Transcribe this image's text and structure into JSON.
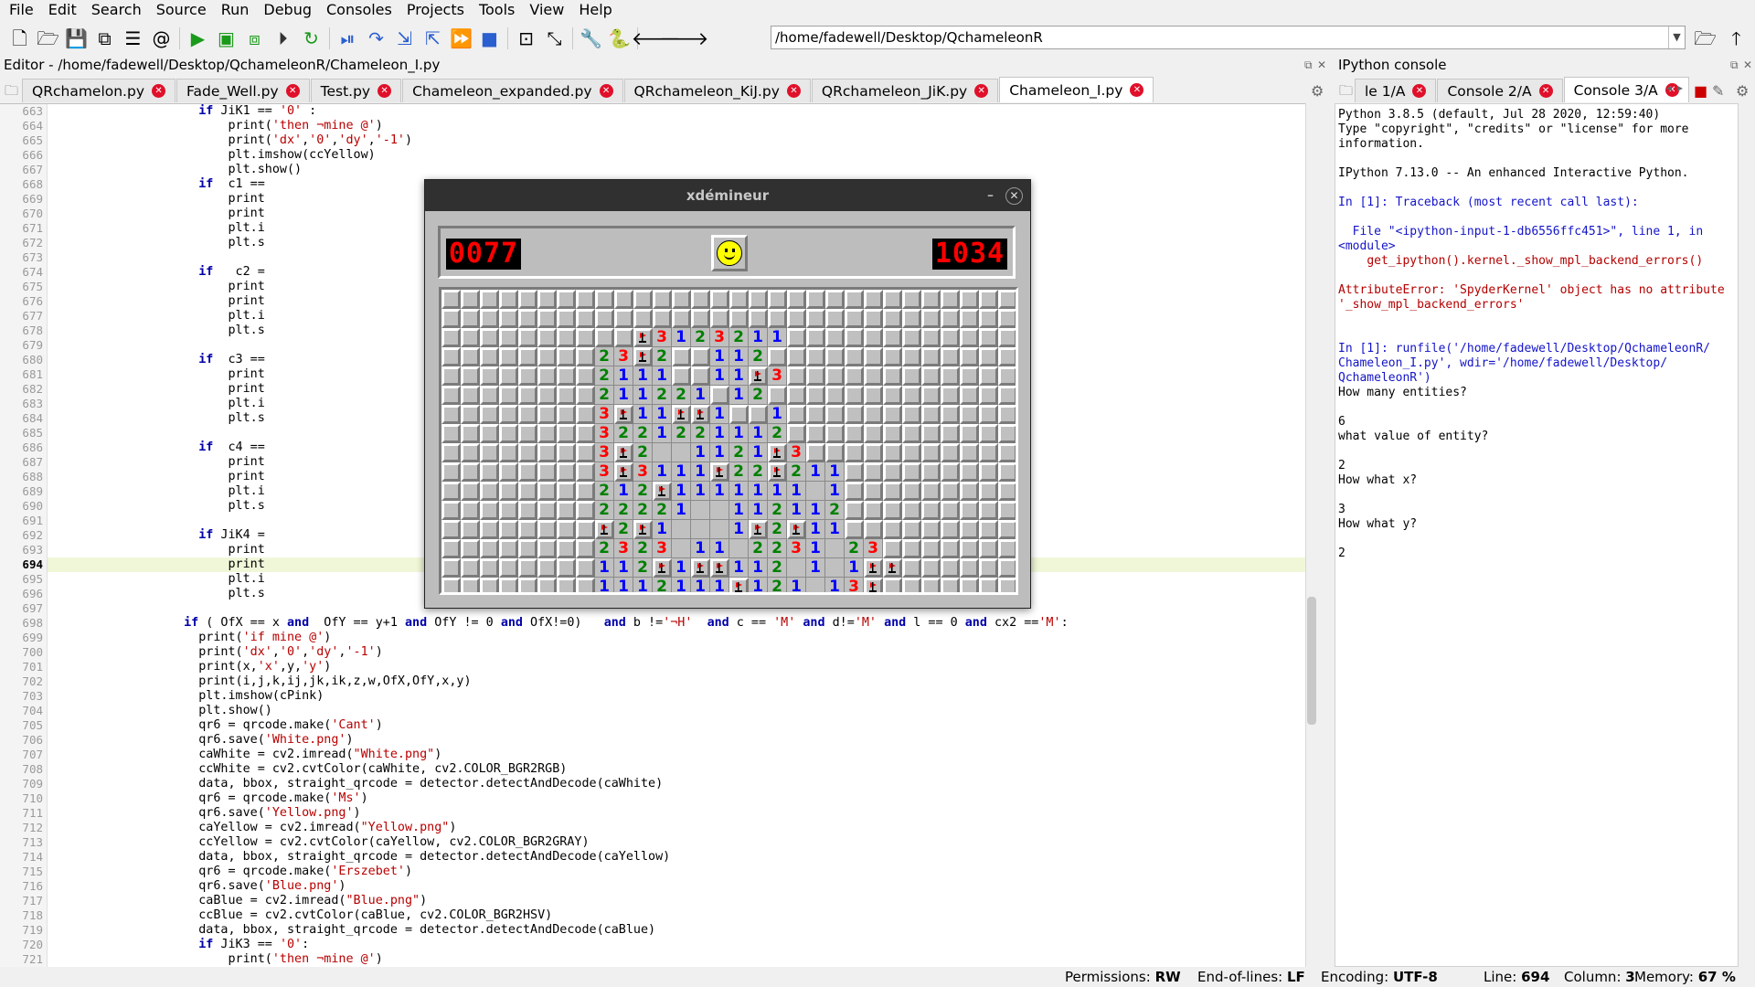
{
  "menu": [
    "File",
    "Edit",
    "Search",
    "Source",
    "Run",
    "Debug",
    "Consoles",
    "Projects",
    "Tools",
    "View",
    "Help"
  ],
  "toolbar": {
    "left_icons": [
      "new-file-icon",
      "open-file-icon",
      "save-icon",
      "save-all-icon",
      "outline-icon",
      "at-sign-icon"
    ],
    "run_icons": [
      "run-icon",
      "run-cell-icon",
      "run-cell-advance-icon",
      "run-selection-icon",
      "rerun-icon"
    ],
    "debug_icons": [
      "debug-icon",
      "step-icon",
      "step-into-icon",
      "step-return-icon",
      "continue-icon",
      "stop-icon"
    ],
    "view_icons": [
      "maximize-pane-icon",
      "fullscreen-icon"
    ],
    "tool_icons": [
      "preferences-icon",
      "python-path-icon"
    ],
    "nav_icons": [
      "back-icon",
      "forward-icon"
    ],
    "path": "/home/fadewell/Desktop/QchameleonR",
    "right_icons": [
      "browse-folder-icon",
      "parent-dir-icon"
    ]
  },
  "editor": {
    "title": "Editor - /home/fadewell/Desktop/QchameleonR/Chameleon_I.py",
    "tabs": [
      {
        "label": "QRchamelon.py",
        "active": false
      },
      {
        "label": "Fade_Well.py",
        "active": false
      },
      {
        "label": "Test.py",
        "active": false
      },
      {
        "label": "Chameleon_expanded.py",
        "active": false
      },
      {
        "label": "QRchameleon_KiJ.py",
        "active": false
      },
      {
        "label": "QRchameleon_JiK.py",
        "active": false
      },
      {
        "label": "Chameleon_I.py",
        "active": true
      }
    ],
    "current_line": 694,
    "line_numbers": [
      663,
      664,
      665,
      666,
      667,
      668,
      669,
      670,
      671,
      672,
      673,
      674,
      675,
      676,
      677,
      678,
      679,
      680,
      681,
      682,
      683,
      684,
      685,
      686,
      687,
      688,
      689,
      690,
      691,
      692,
      693,
      694,
      695,
      696,
      697,
      698,
      699,
      700,
      701,
      702,
      703,
      704,
      705,
      706,
      707,
      708,
      709,
      710,
      711,
      712,
      713,
      714,
      715,
      716,
      717,
      718,
      719,
      720,
      721
    ],
    "lines": [
      "                    if JiK1 == '0' :",
      "                        print('then ¬mine @')",
      "                        print('dx','0','dy','-1')",
      "                        plt.imshow(ccYellow)",
      "                        plt.show()",
      "                    if  c1 ==",
      "                        print",
      "                        print",
      "                        plt.i",
      "                        plt.s",
      "",
      "                    if   c2 =",
      "                        print",
      "                        print",
      "                        plt.i",
      "                        plt.s",
      "",
      "                    if  c3 ==",
      "                        print",
      "                        print",
      "                        plt.i",
      "                        plt.s",
      "",
      "                    if  c4 ==",
      "                        print",
      "                        print",
      "                        plt.i",
      "                        plt.s",
      "",
      "                    if JiK4 =",
      "                        print",
      "                        print",
      "                        plt.i",
      "                        plt.s",
      "",
      "                  if ( OfX == x and  OfY == y+1 and OfY != 0 and OfX!=0)   and b !='¬H'  and c == 'M' and d!='M' and l == 0 and cx2 =='M':",
      "                    print('if mine @')",
      "                    print('dx','0','dy','-1')",
      "                    print(x,'x',y,'y')",
      "                    print(i,j,k,ij,jk,ik,z,w,OfX,OfY,x,y)",
      "                    plt.imshow(cPink)",
      "                    plt.show()",
      "                    qr6 = qrcode.make('Cant')",
      "                    qr6.save('White.png')",
      "                    caWhite = cv2.imread(\"White.png\")",
      "                    ccWhite = cv2.cvtColor(caWhite, cv2.COLOR_BGR2RGB)",
      "                    data, bbox, straight_qrcode = detector.detectAndDecode(caWhite)",
      "                    qr6 = qrcode.make('Ms')",
      "                    qr6.save('Yellow.png')",
      "                    caYellow = cv2.imread(\"Yellow.png\")",
      "                    ccYellow = cv2.cvtColor(caYellow, cv2.COLOR_BGR2GRAY)",
      "                    data, bbox, straight_qrcode = detector.detectAndDecode(caYellow)",
      "                    qr6 = qrcode.make('Erszebet')",
      "                    qr6.save('Blue.png')",
      "                    caBlue = cv2.imread(\"Blue.png\")",
      "                    ccBlue = cv2.cvtColor(caBlue, cv2.COLOR_BGR2HSV)",
      "                    data, bbox, straight_qrcode = detector.detectAndDecode(caBlue)",
      "                    if JiK3 == '0':",
      "                        print('then ¬mine @')"
    ]
  },
  "console": {
    "title": "IPython console",
    "tabs": [
      {
        "label": "le 1/A",
        "active": false
      },
      {
        "label": "Console 2/A",
        "active": false
      },
      {
        "label": "Console 3/A",
        "active": true
      }
    ],
    "lines": [
      {
        "text": "Python 3.8.5 (default, Jul 28 2020, 12:59:40)",
        "cls": ""
      },
      {
        "text": "Type \"copyright\", \"credits\" or \"license\" for more",
        "cls": ""
      },
      {
        "text": "information.",
        "cls": ""
      },
      {
        "text": "",
        "cls": ""
      },
      {
        "text": "IPython 7.13.0 -- An enhanced Interactive Python.",
        "cls": ""
      },
      {
        "text": "",
        "cls": ""
      },
      {
        "text": "In [1]: Traceback (most recent call last):",
        "cls": "cblue"
      },
      {
        "text": "",
        "cls": ""
      },
      {
        "text": "  File \"<ipython-input-1-db6556ffc451>\", line 1, in",
        "cls": "cblue"
      },
      {
        "text": "<module>",
        "cls": "cblue"
      },
      {
        "text": "    get_ipython().kernel._show_mpl_backend_errors()",
        "cls": "cred"
      },
      {
        "text": "",
        "cls": ""
      },
      {
        "text": "AttributeError: 'SpyderKernel' object has no attribute",
        "cls": "cred"
      },
      {
        "text": "'_show_mpl_backend_errors'",
        "cls": "cred"
      },
      {
        "text": "",
        "cls": ""
      },
      {
        "text": "",
        "cls": ""
      },
      {
        "text": "In [1]: runfile('/home/fadewell/Desktop/QchameleonR/",
        "cls": "cblue"
      },
      {
        "text": "Chameleon_I.py', wdir='/home/fadewell/Desktop/",
        "cls": "cblue"
      },
      {
        "text": "QchameleonR')",
        "cls": "cblue"
      },
      {
        "text": "How many entities?",
        "cls": ""
      },
      {
        "text": "",
        "cls": ""
      },
      {
        "text": "6",
        "cls": ""
      },
      {
        "text": "what value of entity?",
        "cls": ""
      },
      {
        "text": "",
        "cls": ""
      },
      {
        "text": "2",
        "cls": ""
      },
      {
        "text": "How what x?",
        "cls": ""
      },
      {
        "text": "",
        "cls": ""
      },
      {
        "text": "3",
        "cls": ""
      },
      {
        "text": "How what y?",
        "cls": ""
      },
      {
        "text": "",
        "cls": ""
      },
      {
        "text": "2",
        "cls": ""
      }
    ]
  },
  "minesweeper": {
    "title": "xdémineur",
    "mine_counter": "0077",
    "timer": "1034",
    "rows": [
      "..............................",
      "..............................",
      "..........F3123211............",
      "........23F2..112.............",
      "........2111..11F3............",
      "........211221.12.............",
      "........3F11FF1..1............",
      "........3221221112............",
      "........3F2  1121F3...........",
      "........3F3111F22F211.........",
      "........212F1111111 1.........",
      "........22221  112112.........",
      "........F2F1   1F2F11.........",
      "........2323 11 2231 23.......",
      "........112F1FF112 1 1FF......",
      "........1112111F121 13F......."
    ],
    "colors": {
      "1": "#0000ff",
      "2": "#008000",
      "3": "#ff0000",
      "flag": "#ff0000"
    }
  },
  "status": {
    "permissions_label": "Permissions:",
    "permissions": "RW",
    "eol_label": "End-of-lines:",
    "eol": "LF",
    "encoding_label": "Encoding:",
    "encoding": "UTF-8",
    "line_label": "Line:",
    "line": "694",
    "column_label": "Column:",
    "column": "3",
    "memory_label": "Memory:",
    "memory": "67 %"
  }
}
